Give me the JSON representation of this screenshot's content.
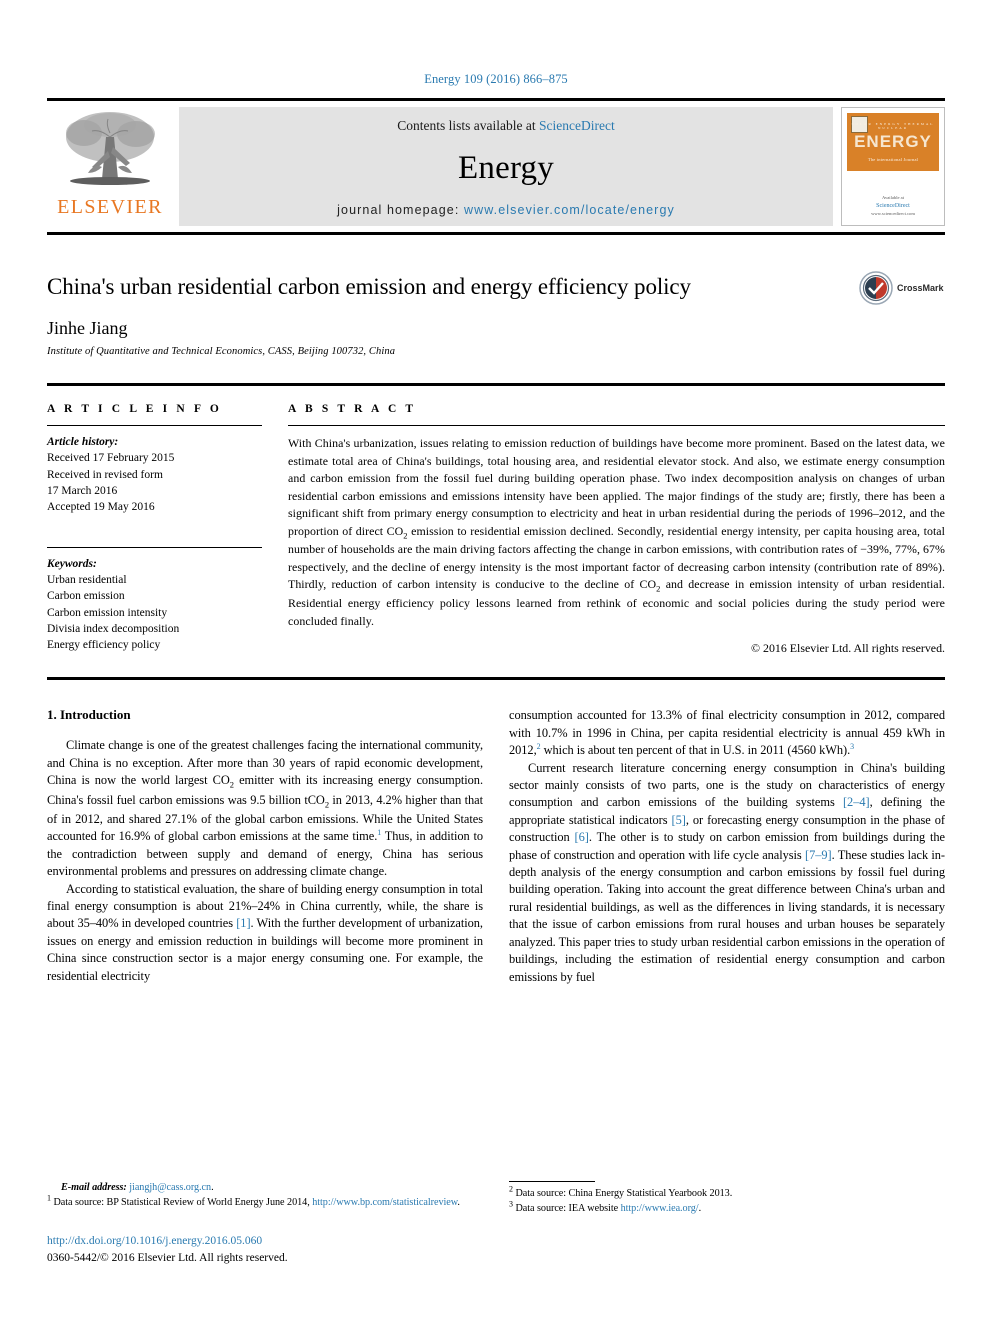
{
  "running_head": "Energy 109 (2016) 866–875",
  "masthead": {
    "contents_prefix": "Contents lists available at ",
    "contents_link": "ScienceDirect",
    "journal_name": "Energy",
    "homepage_label": "journal homepage: ",
    "homepage_url": "www.elsevier.com/locate/energy",
    "publisher_wordmark": "ELSEVIER",
    "cover": {
      "title": "ENERGY",
      "subtitle": "The international Journal",
      "top_band": "SOLAR  ENERGY   THERMAL   NUCLEAR",
      "foot_prefix": "Available at",
      "foot_link": "ScienceDirect",
      "foot_url": "www.sciencedirect.com"
    }
  },
  "article": {
    "title": "China's urban residential carbon emission and energy efficiency policy",
    "author": "Jinhe Jiang",
    "affiliation": "Institute of Quantitative and Technical Economics, CASS, Beijing 100732, China",
    "crossmark_label": "CrossMark"
  },
  "info": {
    "heading": "A R T I C L E   I N F O",
    "history_label": "Article history:",
    "history": [
      "Received 17 February 2015",
      "Received in revised form",
      "17 March 2016",
      "Accepted 19 May 2016"
    ],
    "keywords_label": "Keywords:",
    "keywords": [
      "Urban residential",
      "Carbon emission",
      "Carbon emission intensity",
      "Divisia index decomposition",
      "Energy efficiency policy"
    ]
  },
  "abstract": {
    "heading": "A B S T R A C T",
    "p1_a": "With China's urbanization, issues relating to emission reduction of buildings have become more prominent. Based on the latest data, we estimate total area of China's buildings, total housing area, and residential elevator stock. And also, we estimate energy consumption and carbon emission from the fossil fuel during building operation phase. Two index decomposition analysis on changes of urban residential carbon emissions and emissions intensity have been applied. The major findings of the study are; firstly, there has been a significant shift from primary energy consumption to electricity and heat in urban residential during the periods of 1996–2012, and the proportion of direct CO",
    "p1_b": " emission to residential emission declined. Secondly, residential energy intensity, per capita housing area, total number of households are the main driving factors affecting the change in carbon emissions, with contribution rates of −39%, 77%, 67% respectively, and the decline of energy intensity is the most important factor of decreasing carbon intensity (contribution rate of 89%). Thirdly, reduction of carbon intensity is conducive to the decline of CO",
    "p1_c": " and decrease in emission intensity of urban residential. Residential energy efficiency policy lessons learned from rethink of economic and social policies during the study period were concluded finally.",
    "copyright": "© 2016 Elsevier Ltd. All rights reserved."
  },
  "section": {
    "number_title": "1.  Introduction"
  },
  "left_column": {
    "p1_a": "Climate change is one of the greatest challenges facing the international community, and China is no exception. After more than 30 years of rapid economic development, China is now the world largest CO",
    "p1_b": " emitter with its increasing energy consumption. China's fossil fuel carbon emissions was 9.5 billion tCO",
    "p1_c": " in 2013, 4.2% higher than that of in 2012, and shared 27.1% of the global carbon emissions. While the United States accounted for 16.9% of global carbon emissions at the same time.",
    "p1_note": "1",
    "p1_d": " Thus, in addition to the contradiction between supply and demand of energy, China has serious environmental problems and pressures on addressing climate change.",
    "p2_a": "According to statistical evaluation, the share of building energy consumption in total final energy consumption is about 21%–24% in China currently, while, the share is about 35–40% in developed countries ",
    "p2_ref": "[1]",
    "p2_b": ". With the further development of urbanization, issues on energy and emission reduction in buildings will become more prominent in China since construction sector is a major energy consuming one. For example, the residential electricity"
  },
  "right_column": {
    "p1_a": "consumption accounted for 13.3% of final electricity consumption in 2012, compared with 10.7% in 1996 in China, per capita residential electricity is annual 459 kWh in 2012,",
    "p1_note2": "2",
    "p1_b": " which is about ten percent of that in U.S. in 2011 (4560 kWh).",
    "p1_note3": "3",
    "p2_a": "Current research literature concerning energy consumption in China's building sector mainly consists of two parts, one is the study on characteristics of energy consumption and carbon emissions of the building systems ",
    "p2_ref1": "[2–4]",
    "p2_b": ", defining the appropriate statistical indicators ",
    "p2_ref2": "[5]",
    "p2_c": ", or forecasting energy consumption in the phase of construction ",
    "p2_ref3": "[6]",
    "p2_d": ". The other is to study on carbon emission from buildings during the phase of construction and operation with life cycle analysis ",
    "p2_ref4": "[7–9]",
    "p2_e": ". These studies lack in-depth analysis of the energy consumption and carbon emissions by fossil fuel during building operation. Taking into account the great difference between China's urban and rural residential buildings, as well as the differences in living standards, it is necessary that the issue of carbon emissions from rural houses and urban houses be separately analyzed. This paper tries to study urban residential carbon emissions in the operation of buildings, including the estimation of residential energy consumption and carbon emissions by fuel"
  },
  "footnotes": {
    "email_label": "E-mail address:",
    "email": "jiangjh@cass.org.cn",
    "email_tail": ".",
    "fn1_num": "1",
    "fn1_text": "Data source: BP Statistical Review of World Energy June 2014, ",
    "fn1_link": "http://www.bp.com/statisticalreview",
    "fn1_tail": ".",
    "fn2_num": "2",
    "fn2_text": "Data source: China Energy Statistical Yearbook 2013.",
    "fn3_num": "3",
    "fn3_text": "Data source: IEA website ",
    "fn3_link": "http://www.iea.org/",
    "fn3_tail": ".",
    "doi": "http://dx.doi.org/10.1016/j.energy.2016.05.060",
    "issn_line": "0360-5442/© 2016 Elsevier Ltd. All rights reserved."
  },
  "colors": {
    "link_blue": "#2a7ab0",
    "elsevier_orange": "#e87722",
    "cover_orange": "#d98128",
    "masthead_gray": "#e3e3e3"
  }
}
